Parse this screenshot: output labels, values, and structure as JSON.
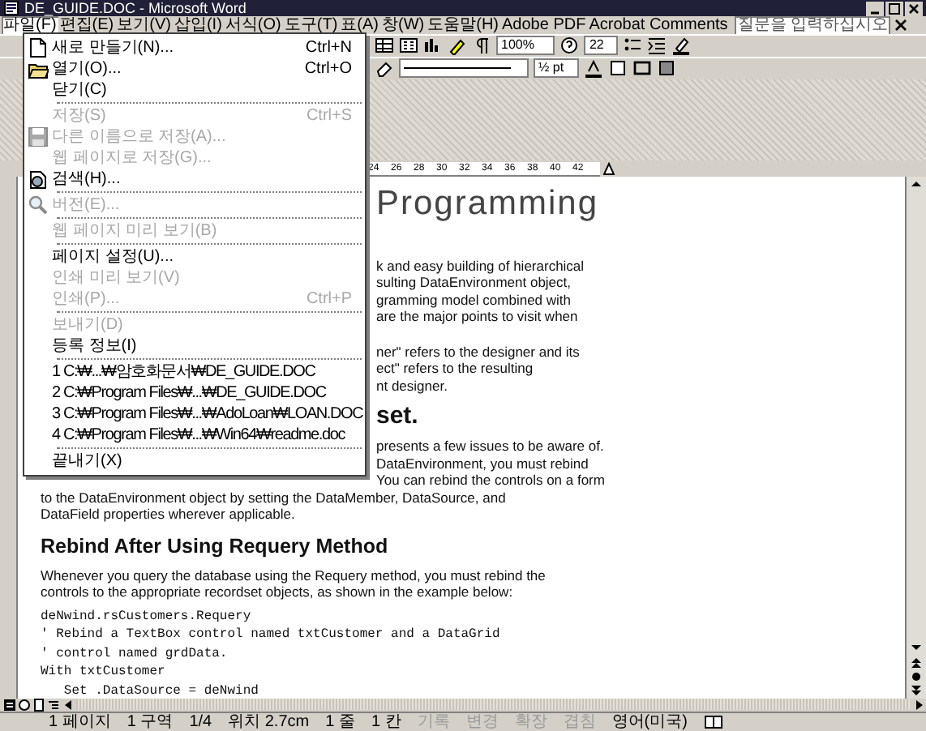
{
  "window": {
    "title": "DE_GUIDE.DOC - Microsoft Word"
  },
  "menu_bar": [
    {
      "label": "파일(F)",
      "selected": true
    },
    {
      "label": "편집(E)",
      "selected": false
    },
    {
      "label": "보기(V)",
      "selected": false
    },
    {
      "label": "삽입(I)",
      "selected": false
    },
    {
      "label": "서식(O)",
      "selected": false
    },
    {
      "label": "도구(T)",
      "selected": false
    },
    {
      "label": "표(A)",
      "selected": false
    },
    {
      "label": "창(W)",
      "selected": false
    },
    {
      "label": "도움말(H)",
      "selected": false
    },
    {
      "label": "Adobe PDF",
      "selected": false
    },
    {
      "label": "Acrobat Comments",
      "selected": false
    }
  ],
  "help_box": {
    "placeholder": "질문을 입력하십시오"
  },
  "toolbars": {
    "zoom": "100%",
    "font_size": "22",
    "line_weight": "½ pt"
  },
  "ruler": {
    "ticks": [
      "24",
      "26",
      "28",
      "30",
      "32",
      "34",
      "36",
      "38",
      "40",
      "42"
    ]
  },
  "file_menu": {
    "items": [
      {
        "kind": "item",
        "label": "새로 만들기(N)...",
        "shortcut": "Ctrl+N",
        "disabled": false
      },
      {
        "kind": "item",
        "label": "열기(O)...",
        "shortcut": "Ctrl+O",
        "disabled": false
      },
      {
        "kind": "item",
        "label": "닫기(C)",
        "disabled": false
      },
      {
        "kind": "separator"
      },
      {
        "kind": "item",
        "label": "저장(S)",
        "shortcut": "Ctrl+S",
        "disabled": true
      },
      {
        "kind": "item",
        "label": "다른 이름으로 저장(A)...",
        "disabled": true
      },
      {
        "kind": "item",
        "label": "웹 페이지로 저장(G)...",
        "disabled": true
      },
      {
        "kind": "item",
        "label": "검색(H)...",
        "disabled": false
      },
      {
        "kind": "separator"
      },
      {
        "kind": "item",
        "label": "버전(E)...",
        "disabled": true
      },
      {
        "kind": "separator"
      },
      {
        "kind": "item",
        "label": "웹 페이지 미리 보기(B)",
        "disabled": true
      },
      {
        "kind": "separator"
      },
      {
        "kind": "item",
        "label": "페이지 설정(U)...",
        "disabled": false
      },
      {
        "kind": "item",
        "label": "인쇄 미리 보기(V)",
        "disabled": true
      },
      {
        "kind": "item",
        "label": "인쇄(P)...",
        "shortcut": "Ctrl+P",
        "disabled": true
      },
      {
        "kind": "separator"
      },
      {
        "kind": "item",
        "label": "보내기(D)",
        "disabled": true
      },
      {
        "kind": "item",
        "label": "등록 정보(I)",
        "disabled": false
      },
      {
        "kind": "separator"
      },
      {
        "kind": "recent",
        "label": "1 C:₩...₩암호화문서₩DE_GUIDE.DOC",
        "disabled": false
      },
      {
        "kind": "recent",
        "label": "2 C:₩Program Files₩...₩DE_GUIDE.DOC",
        "disabled": false
      },
      {
        "kind": "recent",
        "label": "3 C:₩Program Files₩...₩AdoLoan₩LOAN.DOC",
        "disabled": false
      },
      {
        "kind": "recent",
        "label": "4 C:₩Program Files₩...₩Win64₩readme.doc",
        "disabled": false
      },
      {
        "kind": "separator"
      },
      {
        "kind": "item",
        "label": "끝내기(X)",
        "disabled": false
      }
    ]
  },
  "document": {
    "beside_menu": [
      {
        "kind": "title",
        "text": "Programming"
      },
      {
        "kind": "paragraph",
        "lines": [
          "k and easy building of hierarchical",
          "sulting DataEnvironment object,",
          "gramming model combined with",
          "are the major points to visit when"
        ]
      },
      {
        "kind": "paragraph",
        "lines": [
          "ner\" refers to the designer and its",
          "ect\" refers to the resulting",
          "nt designer."
        ]
      },
      {
        "kind": "heading",
        "text": "set."
      },
      {
        "kind": "paragraph",
        "lines": [
          "presents a few issues to be aware of.",
          "DataEnvironment, you must rebind",
          "You can rebind the controls on a form"
        ]
      }
    ],
    "blocks": [
      {
        "kind": "continuation",
        "lines": [
          "to the DataEnvironment object by setting the DataMember, DataSource, and",
          "DataField properties wherever applicable."
        ]
      },
      {
        "kind": "heading",
        "text": "Rebind After Using Requery Method"
      },
      {
        "kind": "paragraph",
        "lines": [
          "Whenever you query the database using the Requery method, you must rebind the",
          "controls to the appropriate recordset objects, as shown in the example below:"
        ]
      },
      {
        "kind": "code",
        "lines": [
          "deNwind.rsCustomers.Requery",
          "' Rebind a TextBox control named txtCustomer and a DataGrid",
          "' control named grdData.",
          "With txtCustomer",
          "   Set .DataSource = deNwind"
        ]
      }
    ]
  },
  "status_bar": [
    {
      "text": "1 페이지",
      "disabled": false
    },
    {
      "text": "1 구역",
      "disabled": false
    },
    {
      "text": "1/4",
      "disabled": false
    },
    {
      "text": "위치 2.7cm",
      "disabled": false
    },
    {
      "text": "1 줄",
      "disabled": false
    },
    {
      "text": "1 칸",
      "disabled": false
    },
    {
      "text": "기록",
      "disabled": true
    },
    {
      "text": "변경",
      "disabled": true
    },
    {
      "text": "확장",
      "disabled": true
    },
    {
      "text": "겹침",
      "disabled": true
    },
    {
      "text": "영어(미국)",
      "disabled": false
    }
  ]
}
